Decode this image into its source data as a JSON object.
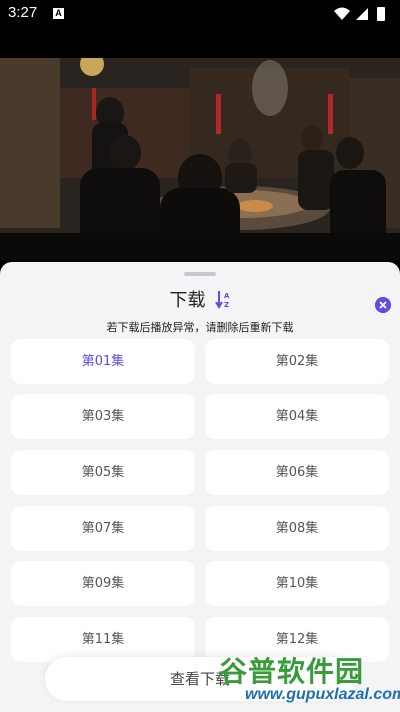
{
  "status_bar": {
    "time": "3:27",
    "notification_icon": "A"
  },
  "sheet": {
    "title": "下载",
    "notice": "若下载后播放异常，请删除后重新下载",
    "episodes": [
      {
        "label": "第01集",
        "selected": true
      },
      {
        "label": "第02集",
        "selected": false
      },
      {
        "label": "第03集",
        "selected": false
      },
      {
        "label": "第04集",
        "selected": false
      },
      {
        "label": "第05集",
        "selected": false
      },
      {
        "label": "第06集",
        "selected": false
      },
      {
        "label": "第07集",
        "selected": false
      },
      {
        "label": "第08集",
        "selected": false
      },
      {
        "label": "第09集",
        "selected": false
      },
      {
        "label": "第10集",
        "selected": false
      },
      {
        "label": "第11集",
        "selected": false
      },
      {
        "label": "第12集",
        "selected": false
      }
    ],
    "bottom_button": "查看下载"
  },
  "watermark": {
    "big": "谷普软件园",
    "small": "www.gupuxlazal.com"
  },
  "colors": {
    "accent": "#5b4ee0",
    "sheet_bg": "#f4f4f6",
    "card_bg": "#ffffff"
  }
}
